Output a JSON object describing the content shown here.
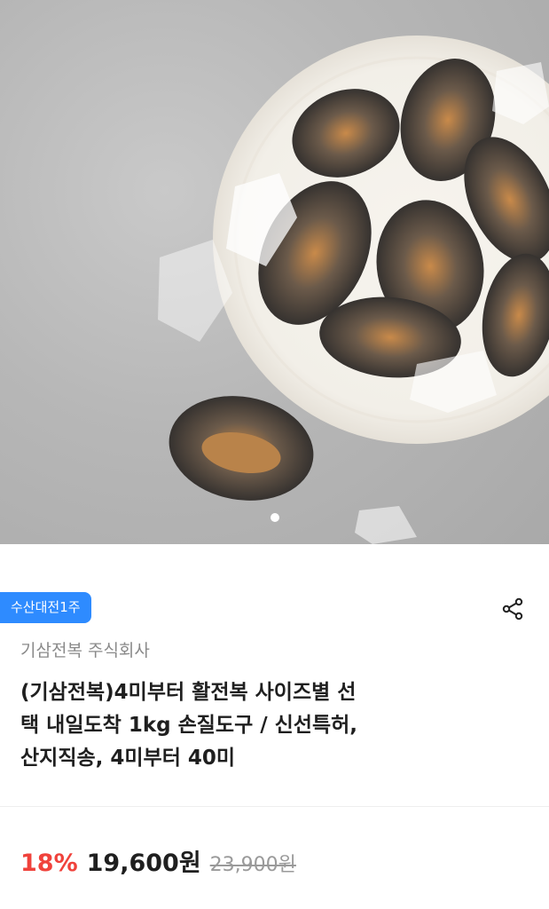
{
  "hero": {
    "image_alt": "abalone on a white plate with ice",
    "carousel": {
      "count": 1,
      "active": 0
    }
  },
  "badge": "수산대전1주",
  "seller": "기삼전복 주식회사",
  "title_lines": [
    "(기삼전복)4미부터 활전복 사이즈별 선",
    "택 내일도착 1kg 손질도구 / 신선특허,",
    "산지직송, 4미부터 40미"
  ],
  "pricing": {
    "discount": "18%",
    "price": "19,600원",
    "original": "23,900원"
  },
  "icons": {
    "share": "share-icon"
  },
  "colors": {
    "badge_bg": "#2e8bff",
    "discount": "#f0423b"
  }
}
